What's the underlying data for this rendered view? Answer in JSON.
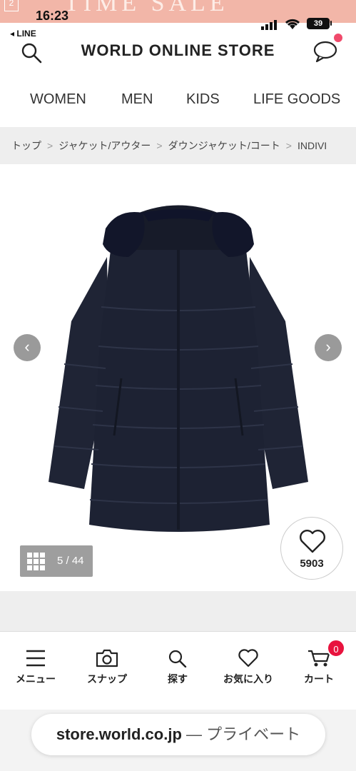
{
  "status_bar": {
    "time": "16:23",
    "battery": "39",
    "banner_text": "TIME SALE"
  },
  "line_back": "◂ LINE",
  "header": {
    "title": "WORLD ONLINE STORE",
    "search_icon": "search-icon",
    "chat_icon": "chat-icon"
  },
  "category_nav": [
    "WOMEN",
    "MEN",
    "KIDS",
    "LIFE GOODS"
  ],
  "breadcrumb": [
    "トップ",
    "ジャケット/アウター",
    "ダウンジャケット/コート",
    "INDIVI"
  ],
  "product_viewer": {
    "image_counter": "5 / 44",
    "favorite_count": "5903",
    "prev_icon": "chevron-left-icon",
    "next_icon": "chevron-right-icon"
  },
  "tab_bar": {
    "items": [
      {
        "label": "メニュー",
        "icon": "menu-icon"
      },
      {
        "label": "スナップ",
        "icon": "camera-icon"
      },
      {
        "label": "探す",
        "icon": "search-icon"
      },
      {
        "label": "お気に入り",
        "icon": "heart-icon"
      },
      {
        "label": "カート",
        "icon": "cart-icon"
      }
    ],
    "cart_count": "0"
  },
  "browser": {
    "domain": "store.world.co.jp",
    "mode": "— プライベート"
  },
  "colors": {
    "banner": "#f2b6a8",
    "cart_badge": "#e8133e",
    "coat": "#1d2233"
  }
}
